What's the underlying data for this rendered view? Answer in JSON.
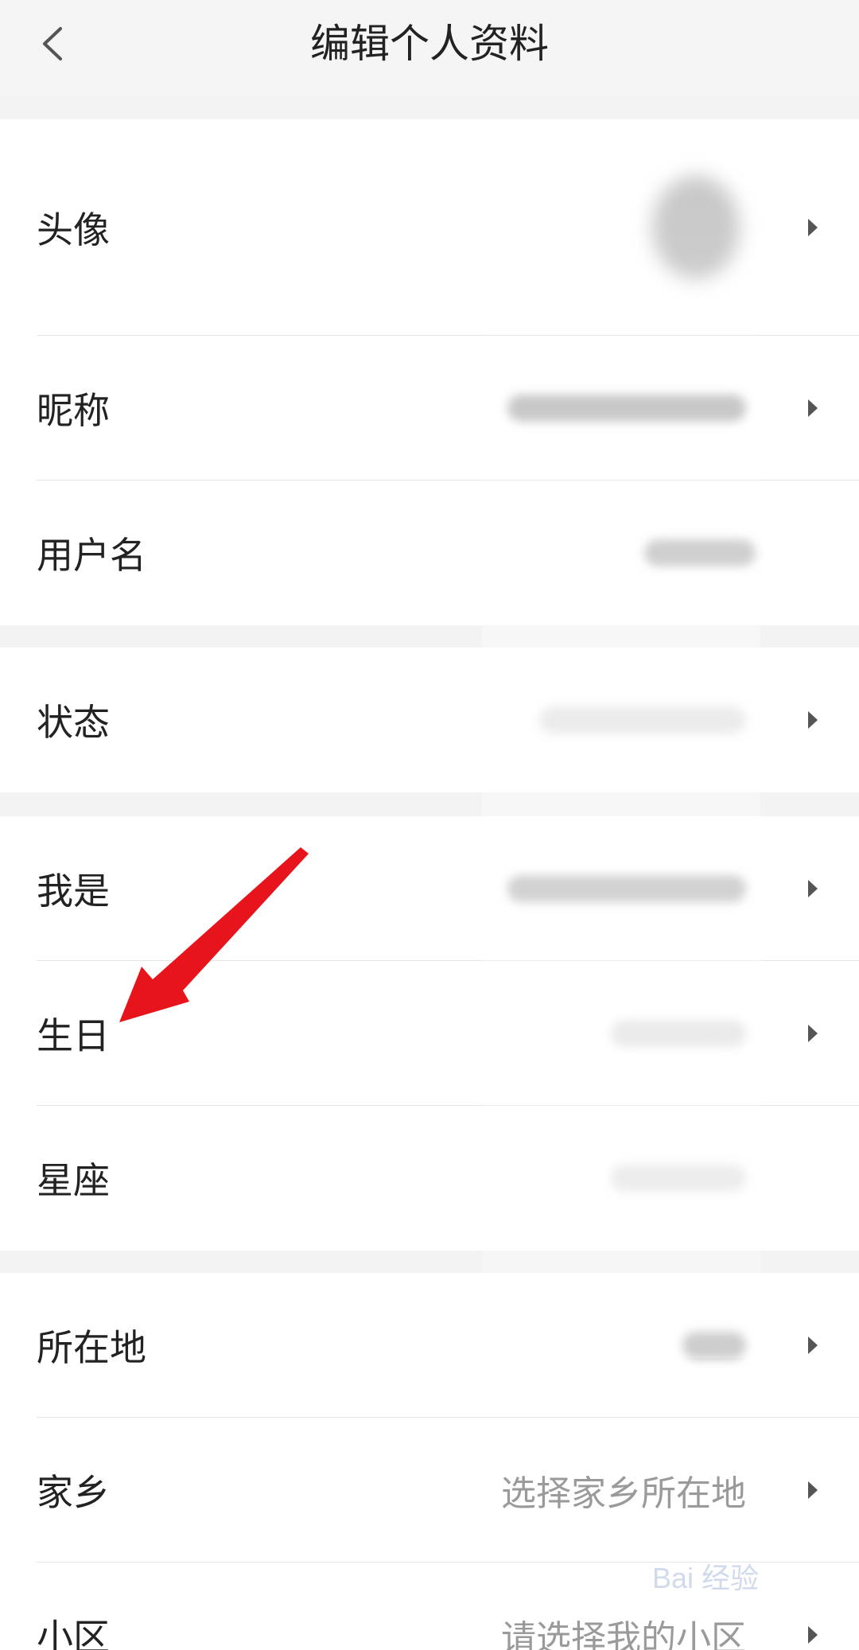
{
  "header": {
    "title": "编辑个人资料"
  },
  "sections": [
    {
      "rows": [
        {
          "label": "头像",
          "value": "",
          "has_chevron": true
        },
        {
          "label": "昵称",
          "value": "",
          "has_chevron": true
        },
        {
          "label": "用户名",
          "value": "",
          "has_chevron": false
        }
      ]
    },
    {
      "rows": [
        {
          "label": "状态",
          "value": "",
          "has_chevron": true
        }
      ]
    },
    {
      "rows": [
        {
          "label": "我是",
          "value": "",
          "has_chevron": true
        },
        {
          "label": "生日",
          "value": "",
          "has_chevron": true
        },
        {
          "label": "星座",
          "value": "",
          "has_chevron": false
        }
      ]
    },
    {
      "rows": [
        {
          "label": "所在地",
          "value": "",
          "has_chevron": true
        },
        {
          "label": "家乡",
          "value": "选择家乡所在地",
          "has_chevron": true
        },
        {
          "label": "小区",
          "value": "请选择我的小区",
          "has_chevron": true
        }
      ]
    }
  ],
  "annotation": {
    "arrow_color": "#e8141b",
    "points_to": "生日"
  },
  "watermark": {
    "text": "Bai 经验"
  },
  "colors": {
    "background": "#f3f3f3",
    "row": "#ffffff",
    "label": "#222222",
    "placeholder": "#9a9a9a"
  }
}
